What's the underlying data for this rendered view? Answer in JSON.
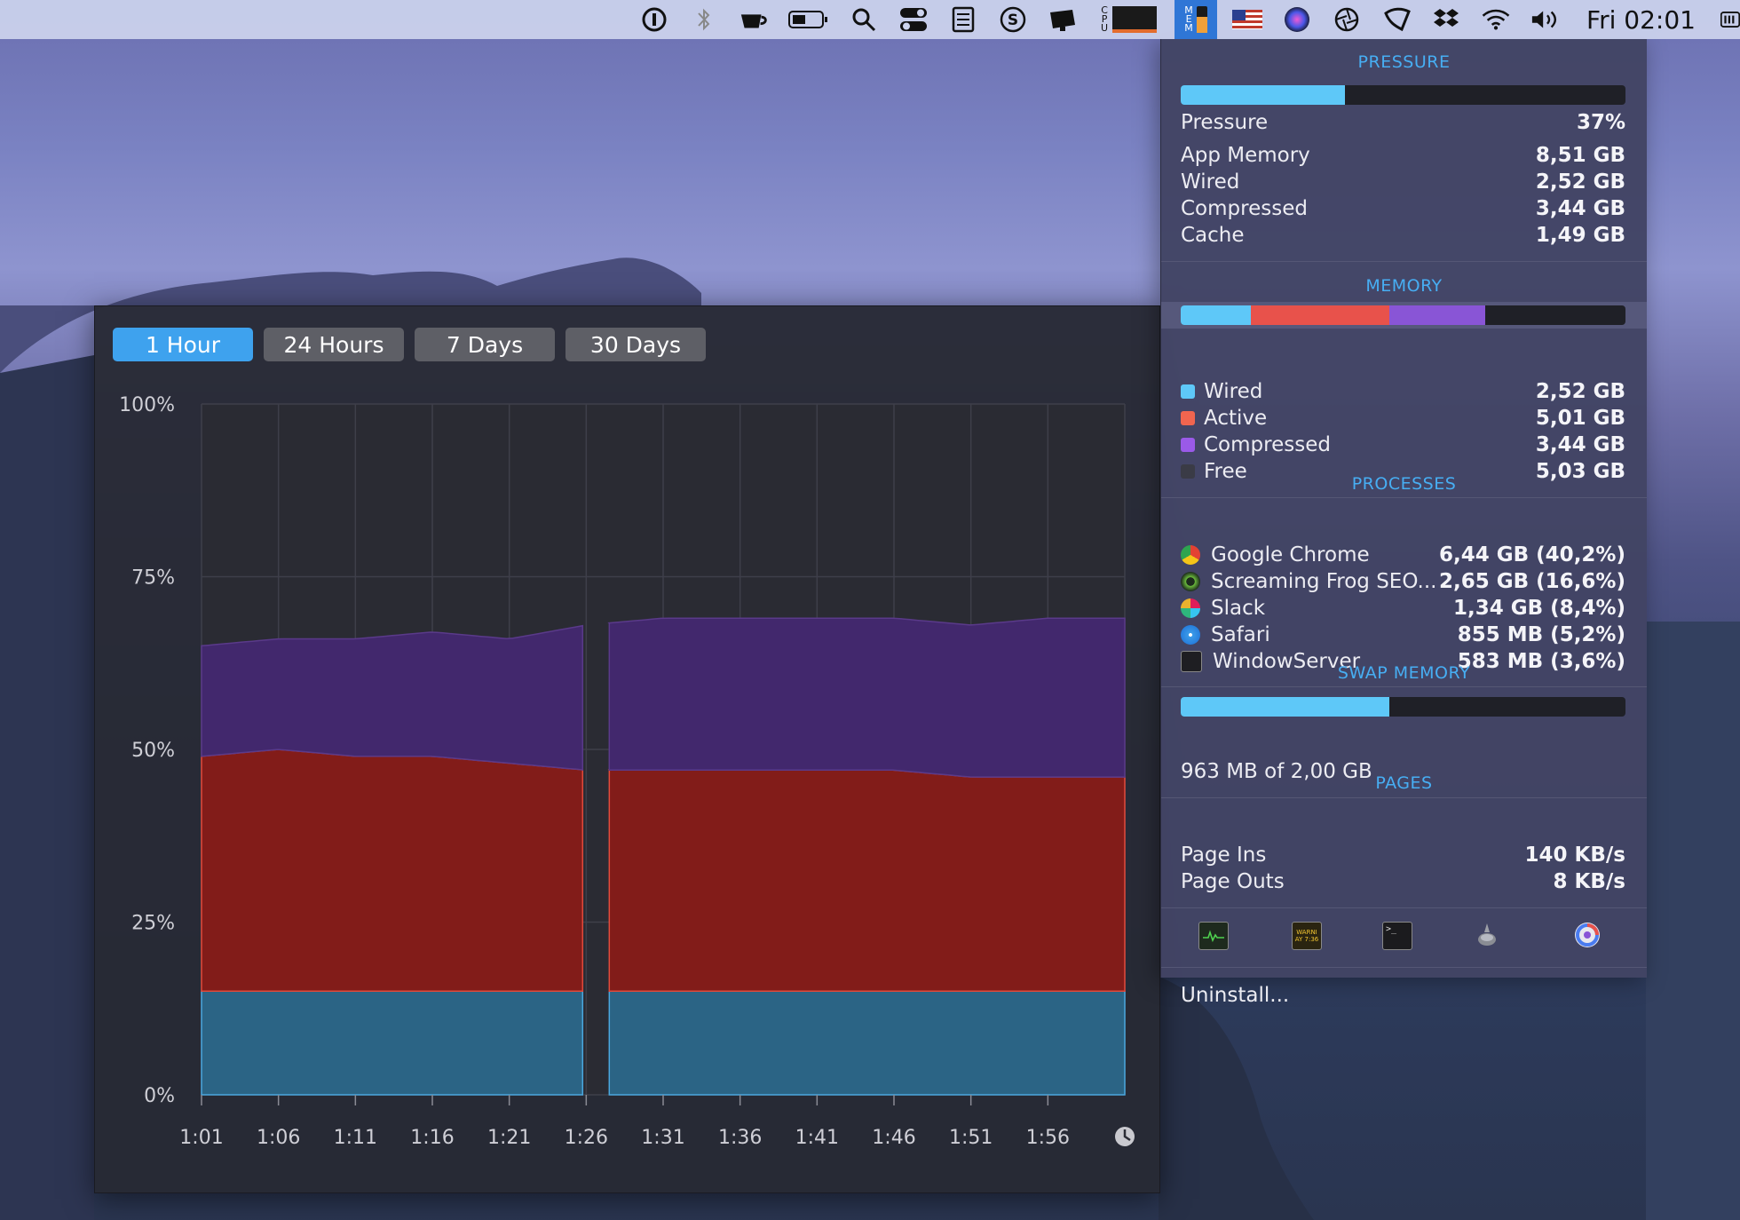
{
  "menubar": {
    "clock": "Fri 02:01",
    "icons": [
      "1password-icon",
      "bluetooth-icon",
      "coffee-cup-icon",
      "battery-icon",
      "spotlight-search-icon",
      "control-center-icon",
      "document-icon",
      "s-circle-icon",
      "dropbox-icon",
      "cpu-monitor-icon",
      "memory-monitor-icon",
      "us-flag-icon",
      "siri-icon",
      "aperture-icon",
      "shield-icon",
      "dropbox-icon",
      "wifi-icon",
      "volume-icon"
    ],
    "cpu_label": "CPU",
    "mem_label": "MEM"
  },
  "history": {
    "tabs": [
      "1 Hour",
      "24 Hours",
      "7 Days",
      "30 Days"
    ],
    "active_tab": "1 Hour",
    "y_labels": [
      "100%",
      "75%",
      "50%",
      "25%",
      "0%"
    ],
    "x_labels": [
      "1:01",
      "1:06",
      "1:11",
      "1:16",
      "1:21",
      "1:26",
      "1:31",
      "1:36",
      "1:41",
      "1:46",
      "1:51",
      "1:56"
    ],
    "clock_icon": "clock-icon"
  },
  "chart_data": {
    "type": "area",
    "title": "",
    "xlabel": "",
    "ylabel": "",
    "ylim": [
      0,
      100
    ],
    "stacked": true,
    "grid": true,
    "x": [
      "1:01",
      "1:06",
      "1:11",
      "1:16",
      "1:21",
      "1:26",
      "1:31",
      "1:36",
      "1:41",
      "1:46",
      "1:51",
      "1:56",
      "2:01"
    ],
    "gap_at": "1:26",
    "series": [
      {
        "color": "#2b6485",
        "values": [
          15,
          15,
          15,
          15,
          15,
          15,
          15,
          15,
          15,
          15,
          15,
          15,
          15
        ]
      },
      {
        "color": "#821c19",
        "values": [
          34,
          35,
          34,
          34,
          33,
          32,
          32,
          32,
          32,
          32,
          31,
          31,
          31
        ]
      },
      {
        "color": "#42286d",
        "values": [
          16,
          16,
          17,
          18,
          18,
          21,
          22,
          22,
          22,
          22,
          22,
          23,
          23
        ]
      }
    ]
  },
  "panel": {
    "pressure": {
      "title": "PRESSURE",
      "fill_fraction": 0.37,
      "rows": [
        {
          "label": "Pressure",
          "value": "37%"
        },
        {
          "label": "App Memory",
          "value": "8,51 GB"
        },
        {
          "label": "Wired",
          "value": "2,52 GB"
        },
        {
          "label": "Compressed",
          "value": "3,44 GB"
        },
        {
          "label": "Cache",
          "value": "1,49 GB"
        }
      ]
    },
    "memory": {
      "title": "MEMORY",
      "segments": [
        {
          "name": "Wired",
          "fraction": 0.157,
          "color": "#5ec8f8"
        },
        {
          "name": "Active",
          "fraction": 0.313,
          "color": "#e8524b"
        },
        {
          "name": "Compressed",
          "fraction": 0.215,
          "color": "#8955d6"
        }
      ],
      "rows": [
        {
          "label": "Wired",
          "value": "2,52 GB",
          "color": "#5ec8f8"
        },
        {
          "label": "Active",
          "value": "5,01 GB",
          "color": "#f0654f"
        },
        {
          "label": "Compressed",
          "value": "3,44 GB",
          "color": "#9a5ae8"
        },
        {
          "label": "Free",
          "value": "5,03 GB",
          "color": "#3a3b46"
        }
      ]
    },
    "processes": {
      "title": "PROCESSES",
      "rows": [
        {
          "label": "Google Chrome",
          "value": "6,44 GB (40,2%)",
          "icon": "chrome-icon"
        },
        {
          "label": "Screaming Frog SEO...",
          "value": "2,65 GB (16,6%)",
          "icon": "screaming-frog-icon"
        },
        {
          "label": "Slack",
          "value": "1,34 GB (8,4%)",
          "icon": "slack-icon"
        },
        {
          "label": "Safari",
          "value": "855 MB (5,2%)",
          "icon": "safari-icon"
        },
        {
          "label": "WindowServer",
          "value": "583 MB (3,6%)",
          "icon": "windowserver-icon"
        }
      ]
    },
    "swap": {
      "title": "SWAP MEMORY",
      "fill_fraction": 0.47,
      "text": "963 MB of 2,00 GB"
    },
    "pages": {
      "title": "PAGES",
      "rows": [
        {
          "label": "Page Ins",
          "value": "140 KB/s"
        },
        {
          "label": "Page Outs",
          "value": "8 KB/s"
        }
      ]
    },
    "tools": [
      "activity-monitor-icon",
      "console-icon",
      "terminal-icon",
      "disk-utility-icon",
      "istat-icon"
    ],
    "tool_warning_text": "WARNI\nAY 7:36",
    "uninstall": "Uninstall..."
  }
}
